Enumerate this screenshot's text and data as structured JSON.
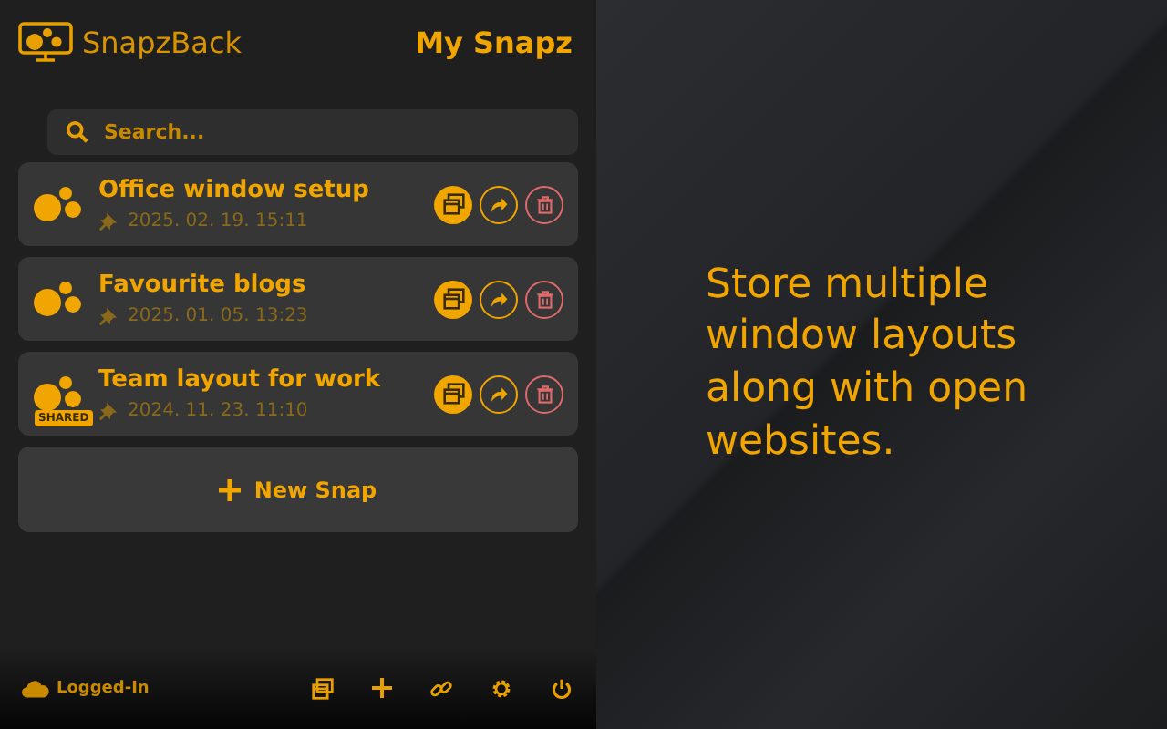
{
  "app": {
    "name": "SnapzBack"
  },
  "header": {
    "title": "My Snapz"
  },
  "search": {
    "placeholder": "Search..."
  },
  "snaps": [
    {
      "title": "Office window setup",
      "date": "2025. 02. 19. 15:11"
    },
    {
      "title": "Favourite blogs",
      "date": "2025. 01. 05. 13:23"
    },
    {
      "title": "Team layout for work",
      "date": "2024. 11. 23. 11:10",
      "badge": "SHARED"
    }
  ],
  "new_snap": {
    "label": "New Snap"
  },
  "status": {
    "label": "Logged-In"
  },
  "tagline": "Store multiple window layouts along with open websites."
}
